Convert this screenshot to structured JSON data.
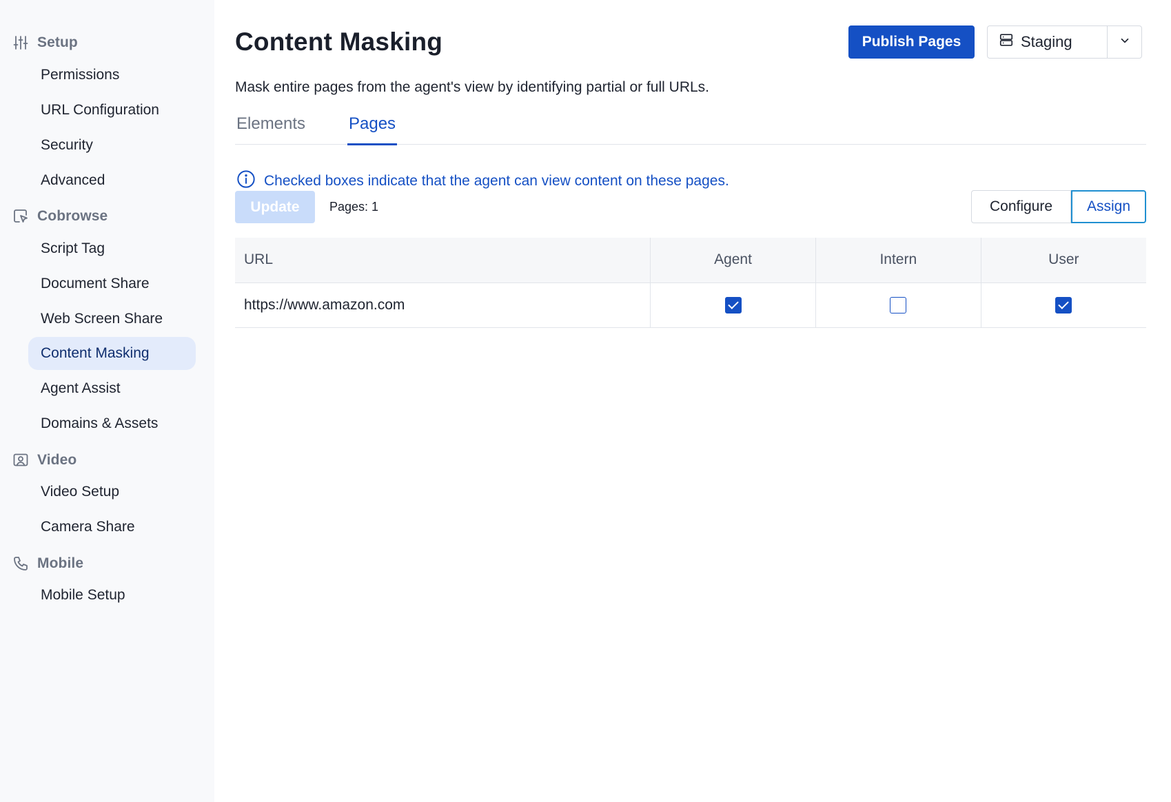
{
  "sidebar": {
    "sections": [
      {
        "label": "Setup",
        "icon": "sliders-icon",
        "items": [
          "Permissions",
          "URL Configuration",
          "Security",
          "Advanced"
        ]
      },
      {
        "label": "Cobrowse",
        "icon": "cursor-screen-icon",
        "items": [
          "Script Tag",
          "Document Share",
          "Web Screen Share",
          "Content Masking",
          "Agent Assist",
          "Domains & Assets"
        ]
      },
      {
        "label": "Video",
        "icon": "video-person-icon",
        "items": [
          "Video Setup",
          "Camera Share"
        ]
      },
      {
        "label": "Mobile",
        "icon": "phone-icon",
        "items": [
          "Mobile Setup"
        ]
      }
    ],
    "active_item": "Content Masking"
  },
  "header": {
    "title": "Content Masking",
    "publish_label": "Publish Pages",
    "environment": "Staging"
  },
  "description": "Mask entire pages from the agent's view by identifying partial or full URLs.",
  "tabs": [
    {
      "label": "Elements",
      "active": false
    },
    {
      "label": "Pages",
      "active": true
    }
  ],
  "info_text": "Checked boxes indicate that the agent can view content on these pages.",
  "actions": {
    "update_label": "Update",
    "pages_count": "Pages: 1",
    "configure_label": "Configure",
    "assign_label": "Assign"
  },
  "table": {
    "columns": [
      "URL",
      "Agent",
      "Intern",
      "User"
    ],
    "rows": [
      {
        "url": "https://www.amazon.com",
        "checks": [
          true,
          false,
          true
        ]
      }
    ]
  },
  "colors": {
    "accent": "#1550c4",
    "active_nav_bg": "#e3ebfb",
    "sidebar_bg": "#f8f9fb",
    "assign_border": "#1f8fd1"
  }
}
